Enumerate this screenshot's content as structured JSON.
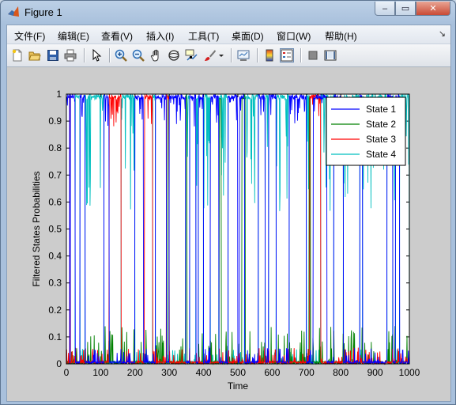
{
  "window": {
    "title": "Figure 1",
    "buttons": {
      "minimize": "–",
      "maximize": "▭",
      "close": "✕"
    }
  },
  "menu": {
    "items": [
      {
        "label": "文件(F)"
      },
      {
        "label": "编辑(E)"
      },
      {
        "label": "查看(V)"
      },
      {
        "label": "插入(I)"
      },
      {
        "label": "工具(T)"
      },
      {
        "label": "桌面(D)"
      },
      {
        "label": "窗口(W)"
      },
      {
        "label": "帮助(H)"
      }
    ],
    "overflow_arrow": "↘"
  },
  "toolbar": {
    "icons": [
      "new-figure-icon",
      "open-file-icon",
      "save-icon",
      "print-icon",
      "select-arrow-icon",
      "zoom-in-icon",
      "zoom-out-icon",
      "pan-hand-icon",
      "rotate-3d-icon",
      "data-cursor-icon",
      "brush-icon",
      "brush-dropdown-icon",
      "link-plot-icon",
      "colorbar-icon",
      "legend-icon",
      "hide-plot-tools-icon",
      "show-plot-tools-icon"
    ],
    "active": "legend-icon"
  },
  "chart_data": {
    "type": "line",
    "xlabel": "Time",
    "ylabel": "Filtered States Probabilities",
    "xlim": [
      0,
      1000
    ],
    "ylim": [
      0,
      1
    ],
    "xticks": [
      "0",
      "100",
      "200",
      "300",
      "400",
      "500",
      "600",
      "700",
      "800",
      "900",
      "1000"
    ],
    "yticks": [
      "0",
      "0.1",
      "0.2",
      "0.3",
      "0.4",
      "0.5",
      "0.6",
      "0.7",
      "0.8",
      "0.9",
      "1"
    ],
    "legend_position": "top-right",
    "series": [
      {
        "name": "State 1",
        "color": "#0000ff",
        "regimes": [
          [
            0,
            10
          ],
          [
            12,
            26
          ],
          [
            40,
            55
          ],
          [
            110,
            125
          ],
          [
            200,
            225
          ],
          [
            260,
            292
          ],
          [
            300,
            348
          ],
          [
            360,
            378
          ],
          [
            385,
            400
          ],
          [
            420,
            445
          ],
          [
            472,
            500
          ],
          [
            505,
            520
          ],
          [
            560,
            580
          ],
          [
            590,
            612
          ],
          [
            650,
            700
          ],
          [
            720,
            760
          ],
          [
            780,
            808
          ],
          [
            856,
            864
          ],
          [
            935,
            952
          ],
          [
            960,
            972
          ]
        ]
      },
      {
        "name": "State 2",
        "color": "#008000",
        "regimes": [
          [
            296,
            300
          ],
          [
            348,
            352
          ],
          [
            446,
            452
          ],
          [
            512,
            522
          ],
          [
            708,
            712
          ]
        ]
      },
      {
        "name": "State 3",
        "color": "#ff0000",
        "regimes": [
          [
            10,
            12
          ],
          [
            125,
            160
          ],
          [
            228,
            252
          ],
          [
            292,
            300
          ],
          [
            710,
            742
          ]
        ]
      },
      {
        "name": "State 4",
        "color": "#00bfbf",
        "regimes": [
          [
            26,
            40
          ],
          [
            55,
            110
          ],
          [
            160,
            200
          ],
          [
            252,
            260
          ],
          [
            348,
            360
          ],
          [
            378,
            385
          ],
          [
            400,
            420
          ],
          [
            445,
            472
          ],
          [
            520,
            560
          ],
          [
            580,
            590
          ],
          [
            612,
            650
          ],
          [
            700,
            710
          ],
          [
            742,
            780
          ],
          [
            808,
            856
          ],
          [
            864,
            935
          ],
          [
            952,
            960
          ],
          [
            972,
            1000
          ]
        ]
      }
    ]
  }
}
